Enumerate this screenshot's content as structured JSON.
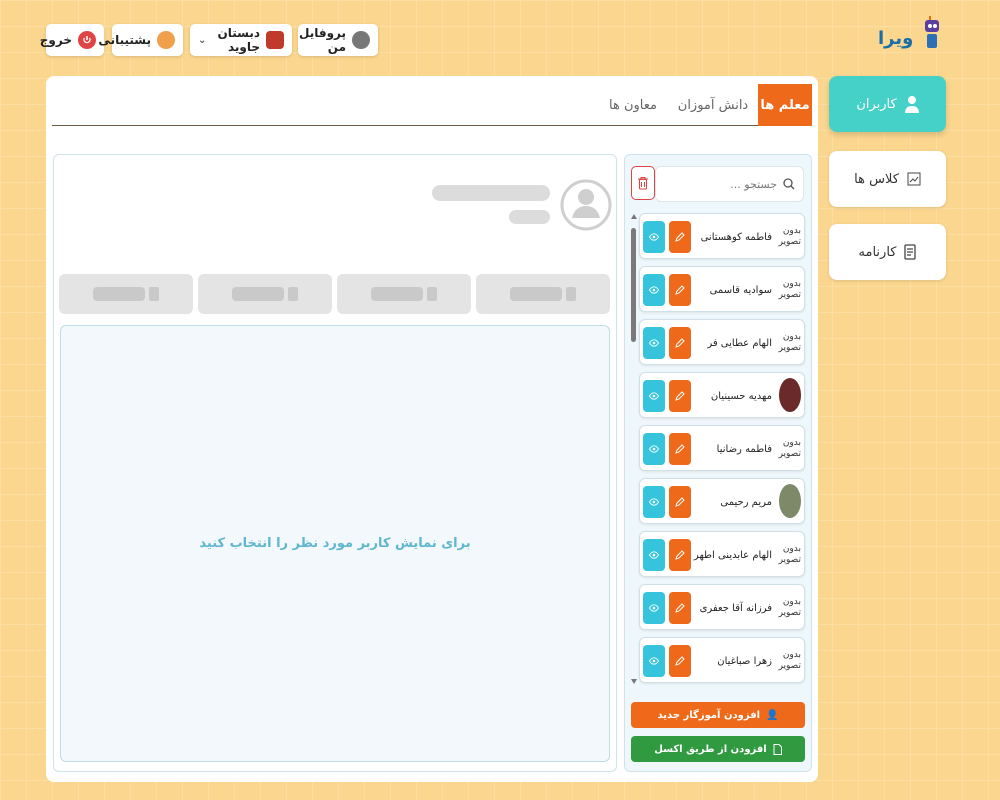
{
  "header": {
    "logout_label": "خروج",
    "support_label": "پشتیبانی",
    "school_label": "دبستان جاوید",
    "profile_label": "پروفایل من"
  },
  "logo": {
    "text": "ویرا"
  },
  "nav": {
    "users_label": "کاربران",
    "classes_label": "کلاس ها",
    "reportcard_label": "کارنامه"
  },
  "tabs": {
    "teachers": "معلم ها",
    "students": "دانش آموزان",
    "deputies": "معاون ها"
  },
  "search": {
    "placeholder": "جستجو ..."
  },
  "no_photo_label": "بدون تصویر",
  "users": [
    {
      "name": "فاطمه کوهستانی",
      "photo": "none"
    },
    {
      "name": "سوادیه قاسمی",
      "photo": "none"
    },
    {
      "name": "الهام عطایی فر",
      "photo": "none"
    },
    {
      "name": "مهدیه حسینیان",
      "photo": "image"
    },
    {
      "name": "فاطمه رضانیا",
      "photo": "none"
    },
    {
      "name": "مریم رحیمی",
      "photo": "image"
    },
    {
      "name": "الهام عابدینی اطهر",
      "photo": "none"
    },
    {
      "name": "فرزانه آقا جعفری",
      "photo": "none"
    },
    {
      "name": "زهرا صباغیان",
      "photo": "none"
    }
  ],
  "buttons": {
    "add_teacher": "افزودن آموزگار جدید",
    "add_excel": "افزودن از طریق اکسل"
  },
  "empty_message": "برای نمایش کاربر مورد نظر را انتخاب کنید",
  "colors": {
    "accent_orange": "#ee6a1a",
    "accent_teal": "#46d1c8",
    "accent_cyan": "#35c4dc",
    "excel_green": "#2f9a40",
    "background": "#fbd68e"
  }
}
